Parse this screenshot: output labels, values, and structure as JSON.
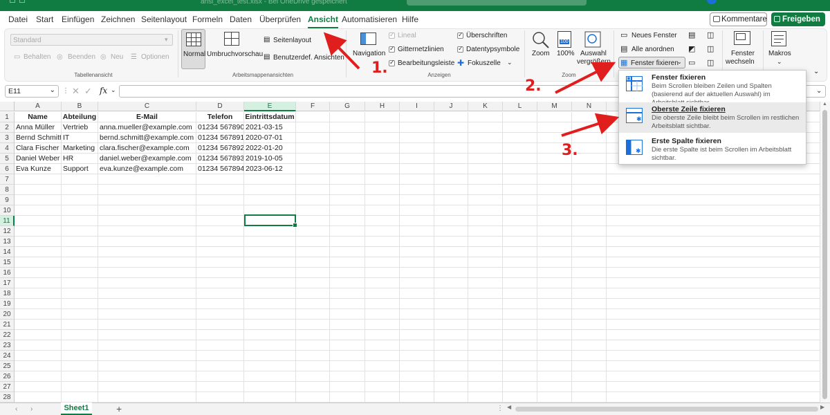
{
  "titlebar": {
    "doc_title": "ansi_excel_test.xlsx - Bei OneDrive gespeichert"
  },
  "menu": {
    "tabs": [
      "Datei",
      "Start",
      "Einfügen",
      "Zeichnen",
      "Seitenlayout",
      "Formeln",
      "Daten",
      "Überprüfen",
      "Ansicht",
      "Automatisieren",
      "Hilfe"
    ],
    "active": "Ansicht",
    "comments_label": "Kommentare",
    "share_label": "Freigeben"
  },
  "ribbon": {
    "sheetview": {
      "select_value": "Standard",
      "keep": "Behalten",
      "exit": "Beenden",
      "new": "Neu",
      "options": "Optionen",
      "group_label": "Tabellenansicht"
    },
    "workbookviews": {
      "normal": "Normal",
      "pagebreak": "Umbruchvorschau",
      "pagelayout": "Seitenlayout",
      "custom": "Benutzerdef. Ansichten",
      "group_label": "Arbeitsmappenansichten"
    },
    "show": {
      "navigation": "Navigation",
      "ruler": "Lineal",
      "gridlines": "Gitternetzlinien",
      "formulabar": "Bearbeitungsleiste",
      "headings": "Überschriften",
      "datatypeicons": "Datentypsymbole",
      "focuscell": "Fokuszelle",
      "group_label": "Anzeigen"
    },
    "zoom": {
      "zoom": "Zoom",
      "hundred": "100%",
      "zoom_selection_1": "Auswahl",
      "zoom_selection_2": "vergrößern",
      "group_label": "Zoom",
      "icon_100": "100"
    },
    "window": {
      "new_window": "Neues Fenster",
      "arrange_all": "Alle anordnen",
      "freeze": "Fenster fixieren",
      "switch_1": "Fenster",
      "switch_2": "wechseln",
      "macros": "Makros"
    }
  },
  "formulabar": {
    "namebox": "E11",
    "fx": "fx"
  },
  "sheet": {
    "columns": [
      "A",
      "B",
      "C",
      "D",
      "E",
      "F",
      "G",
      "H",
      "I",
      "J",
      "K",
      "L",
      "M",
      "N"
    ],
    "selected_col": "E",
    "selected_row": 11,
    "header_row": [
      "Name",
      "Abteilung",
      "E-Mail",
      "Telefon",
      "Eintrittsdatum"
    ],
    "rows": [
      [
        "Anna Müller",
        "Vertrieb",
        "anna.mueller@example.com",
        "01234 567890",
        "2021-03-15"
      ],
      [
        "Bernd Schmitt",
        "IT",
        "bernd.schmitt@example.com",
        "01234 567891",
        "2020-07-01"
      ],
      [
        "Clara Fischer",
        "Marketing",
        "clara.fischer@example.com",
        "01234 567892",
        "2022-01-20"
      ],
      [
        "Daniel Weber",
        "HR",
        "daniel.weber@example.com",
        "01234 567893",
        "2019-10-05"
      ],
      [
        "Eva Kunze",
        "Support",
        "eva.kunze@example.com",
        "01234 567894",
        "2023-06-12"
      ]
    ],
    "row_count": 28,
    "sheet_tab": "Sheet1",
    "add_sheet": "+"
  },
  "dropdown": {
    "items": [
      {
        "title": "Fenster fixieren",
        "desc": "Beim Scrollen bleiben Zeilen und Spalten (basierend auf der aktuellen Auswahl) im Arbeitsblatt sichtbar."
      },
      {
        "title": "Oberste Zeile fixieren",
        "desc": "Die oberste Zeile bleibt beim Scrollen im restlichen Arbeitsblatt sichtbar."
      },
      {
        "title": "Erste Spalte fixieren",
        "desc": "Die erste Spalte ist beim Scrollen im Arbeitsblatt sichtbar."
      }
    ]
  },
  "annotations": {
    "one": "1.",
    "two": "2.",
    "three": "3."
  },
  "colors": {
    "excel_green": "#107c41",
    "annotation_red": "#e01e1e"
  }
}
